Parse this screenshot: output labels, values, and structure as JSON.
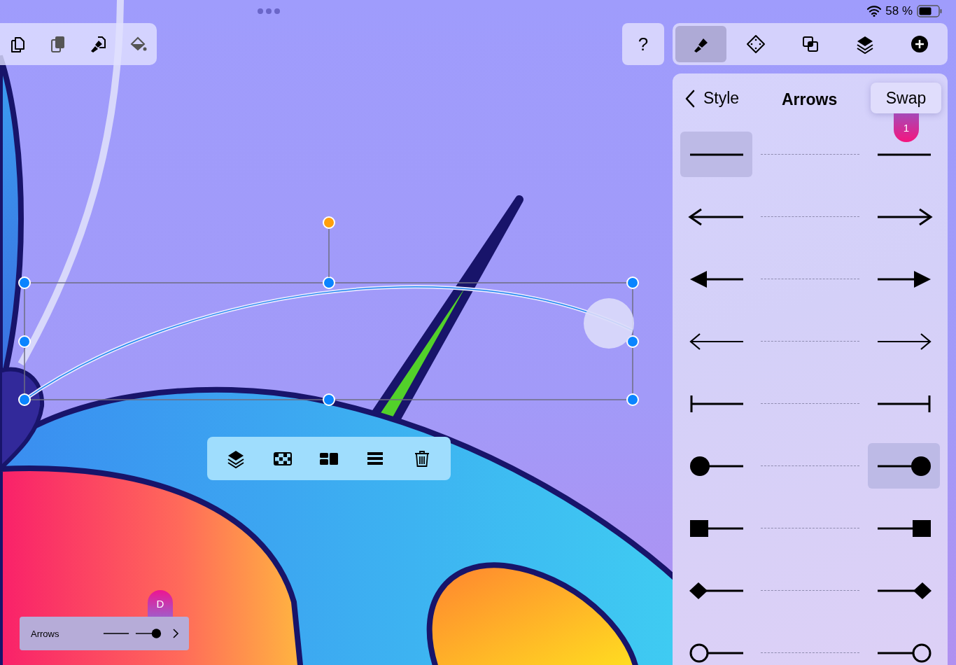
{
  "status_bar": {
    "battery": "58 %"
  },
  "file_toolbar": [
    {
      "kind": "copy",
      "disabled": false
    },
    {
      "kind": "paste",
      "disabled": true
    },
    {
      "kind": "paste-style",
      "disabled": false
    },
    {
      "kind": "fill",
      "disabled": true
    }
  ],
  "help_button": {
    "label": "?"
  },
  "inspector_tabs": [
    {
      "kind": "style",
      "selected": true
    },
    {
      "kind": "points",
      "selected": false
    },
    {
      "kind": "combine",
      "selected": false
    },
    {
      "kind": "layers",
      "selected": false
    },
    {
      "kind": "add",
      "selected": false
    }
  ],
  "panel": {
    "back": "Style",
    "title": "Arrows",
    "swap": "Swap",
    "swap_badge": "1",
    "rows": [
      {
        "kind": "none",
        "start_selected": true,
        "end_selected": false
      },
      {
        "kind": "arrow",
        "start_selected": false,
        "end_selected": false
      },
      {
        "kind": "triangle",
        "start_selected": false,
        "end_selected": false
      },
      {
        "kind": "open",
        "start_selected": false,
        "end_selected": false
      },
      {
        "kind": "bar",
        "start_selected": false,
        "end_selected": false
      },
      {
        "kind": "circle",
        "start_selected": false,
        "end_selected": true
      },
      {
        "kind": "square",
        "start_selected": false,
        "end_selected": false
      },
      {
        "kind": "diamond",
        "start_selected": false,
        "end_selected": false
      },
      {
        "kind": "ring",
        "start_selected": false,
        "end_selected": false
      }
    ]
  },
  "selection_toolbar": [
    {
      "kind": "arrange"
    },
    {
      "kind": "opacity"
    },
    {
      "kind": "layout"
    },
    {
      "kind": "align"
    },
    {
      "kind": "delete"
    }
  ],
  "arrows_widget": {
    "label": "Arrows",
    "badge": "D",
    "preview": [
      {
        "kind": "none"
      },
      {
        "kind": "circle"
      }
    ]
  }
}
